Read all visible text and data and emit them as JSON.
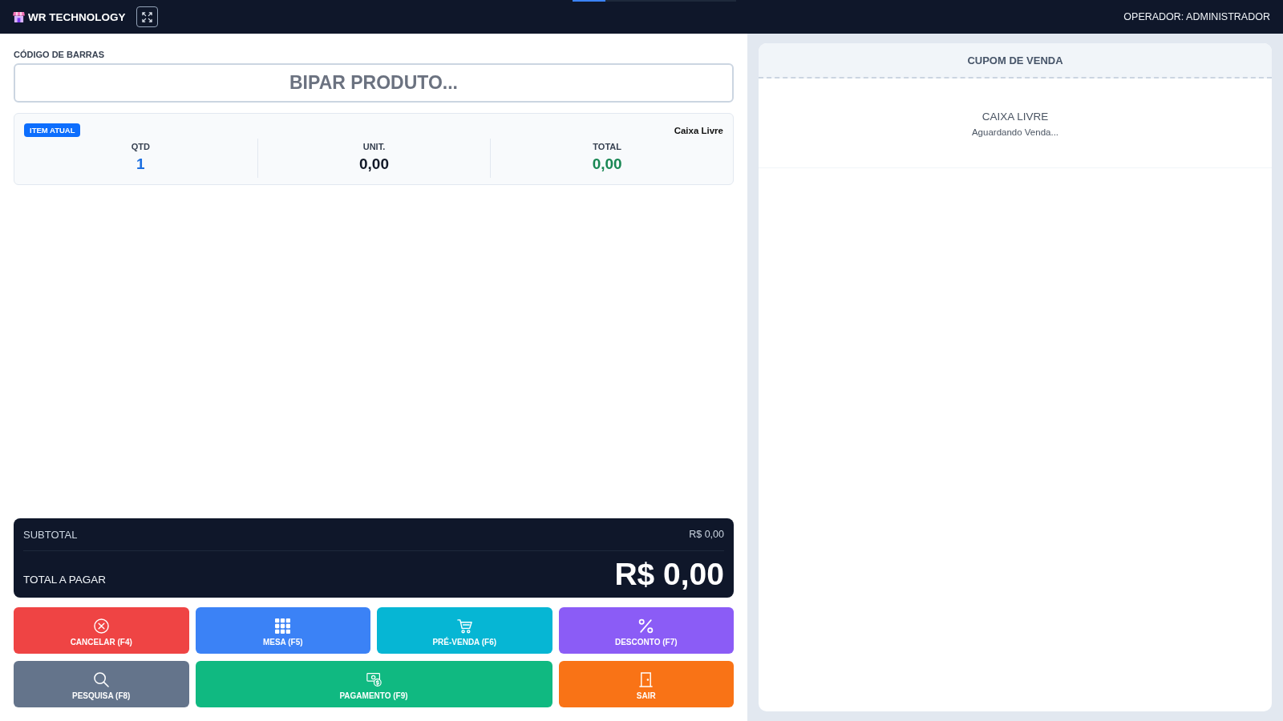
{
  "header": {
    "brand": "WR TECHNOLOGY",
    "operator": "OPERADOR: ADMINISTRADOR",
    "progress": {
      "level": 0.2
    }
  },
  "barcode": {
    "label": "CÓDIGO DE BARRAS",
    "placeholder": "BIPAR PRODUTO..."
  },
  "current_item": {
    "badge": "ITEM ATUAL",
    "status": "Caixa Livre",
    "fields": [
      {
        "label": "QTD",
        "value": "1",
        "color": "#1d6fe0"
      },
      {
        "label": "UNIT.",
        "value": "0,00",
        "color": "#111827"
      },
      {
        "label": "TOTAL",
        "value": "0,00",
        "color": "#198754"
      }
    ]
  },
  "totals": {
    "subtotal_label": "SUBTOTAL",
    "subtotal_value": "R$ 0,00",
    "total_label": "TOTAL A PAGAR",
    "total_value": "R$ 0,00"
  },
  "actions": [
    {
      "label": "CANCELAR (F4)",
      "kind": "cancel",
      "color": "#ef4444",
      "wide": false
    },
    {
      "label": "MESA (F5)",
      "kind": "tables",
      "color": "#3b82f6",
      "wide": false
    },
    {
      "label": "PRÉ-VENDA (F6)",
      "kind": "cart",
      "color": "#06b6d4",
      "wide": false
    },
    {
      "label": "DESCONTO (F7)",
      "kind": "discount",
      "color": "#8b5cf6",
      "wide": false
    },
    {
      "label": "PESQUISA (F8)",
      "kind": "search",
      "color": "#64748b",
      "wide": false
    },
    {
      "label": "PAGAMENTO (F9)",
      "kind": "payment",
      "color": "#10b981",
      "wide": true
    },
    {
      "label": "SAIR",
      "kind": "exit",
      "color": "#f97316",
      "wide": false
    }
  ],
  "receipt": {
    "title": "CUPOM DE VENDA",
    "empty_title": "CAIXA LIVRE",
    "empty_subtitle": "Aguardando Venda..."
  }
}
